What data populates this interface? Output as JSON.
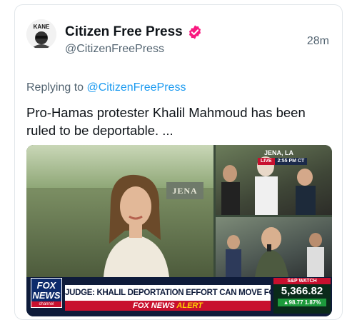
{
  "tweet": {
    "display_name": "Citizen Free Press",
    "handle": "@CitizenFreePress",
    "time": "28m",
    "avatar_text": "KANE",
    "verified_color": "#f91880",
    "replying_prefix": "Replying to",
    "replying_to": "@CitizenFreePress",
    "text": "Pro-Hamas protester Khalil Mahmoud has been ruled to be deportable. ..."
  },
  "media": {
    "location": "JENA, LA",
    "live_label": "LIVE",
    "clock": "2:55 PM CT",
    "gate_sign": "JENA",
    "network_top": "FOX",
    "network_bottom": "NEWS",
    "network_sub": "channel",
    "headline": "JUDGE: KHALIL DEPORTATION EFFORT CAN MOVE FORWARD",
    "alert_left": "FOX NEWS",
    "alert_right": "ALERT",
    "ticker_label": "S&P WATCH",
    "ticker_value": "5,366.82",
    "ticker_change": "▲98.77 1.87%"
  }
}
